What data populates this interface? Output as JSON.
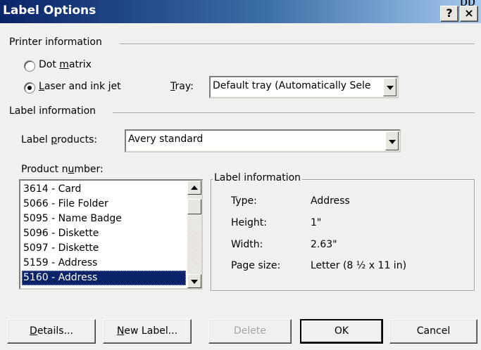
{
  "window": {
    "title": "Label Options",
    "corner_text": "pp"
  },
  "title_buttons": {
    "help": "?",
    "close": "×"
  },
  "printer": {
    "section": "Printer information",
    "dot_matrix": {
      "pre": "Dot ",
      "key": "m",
      "post": "atrix"
    },
    "laser": {
      "pre": "",
      "key": "L",
      "post": "aser and ink jet"
    },
    "tray_label": {
      "pre": "",
      "key": "T",
      "post": "ray:"
    },
    "tray_value": "Default tray (Automatically Sele"
  },
  "label": {
    "section": "Label information",
    "products_label": {
      "pre": "Label ",
      "key": "p",
      "post": "roducts:"
    },
    "products_value": "Avery standard",
    "product_number_label": {
      "pre": "Product n",
      "key": "u",
      "post": "mber:"
    },
    "product_numbers": [
      "3614 - Card",
      "5066 - File Folder",
      "5095 - Name Badge",
      "5096 - Diskette",
      "5097 - Diskette",
      "5159 - Address",
      "5160 - Address"
    ],
    "selected_index": 6
  },
  "info": {
    "title": "Label information",
    "rows": [
      {
        "key": "Type:",
        "value": "Address"
      },
      {
        "key": "Height:",
        "value": "1\""
      },
      {
        "key": "Width:",
        "value": "2.63\""
      },
      {
        "key": "Page size:",
        "value": "Letter (8 ½ x 11 in)"
      }
    ]
  },
  "buttons": {
    "details": {
      "pre": "",
      "key": "D",
      "post": "etails..."
    },
    "new_label": {
      "pre": "",
      "key": "N",
      "post": "ew Label..."
    },
    "delete": "Delete",
    "ok": "OK",
    "cancel": "Cancel"
  }
}
